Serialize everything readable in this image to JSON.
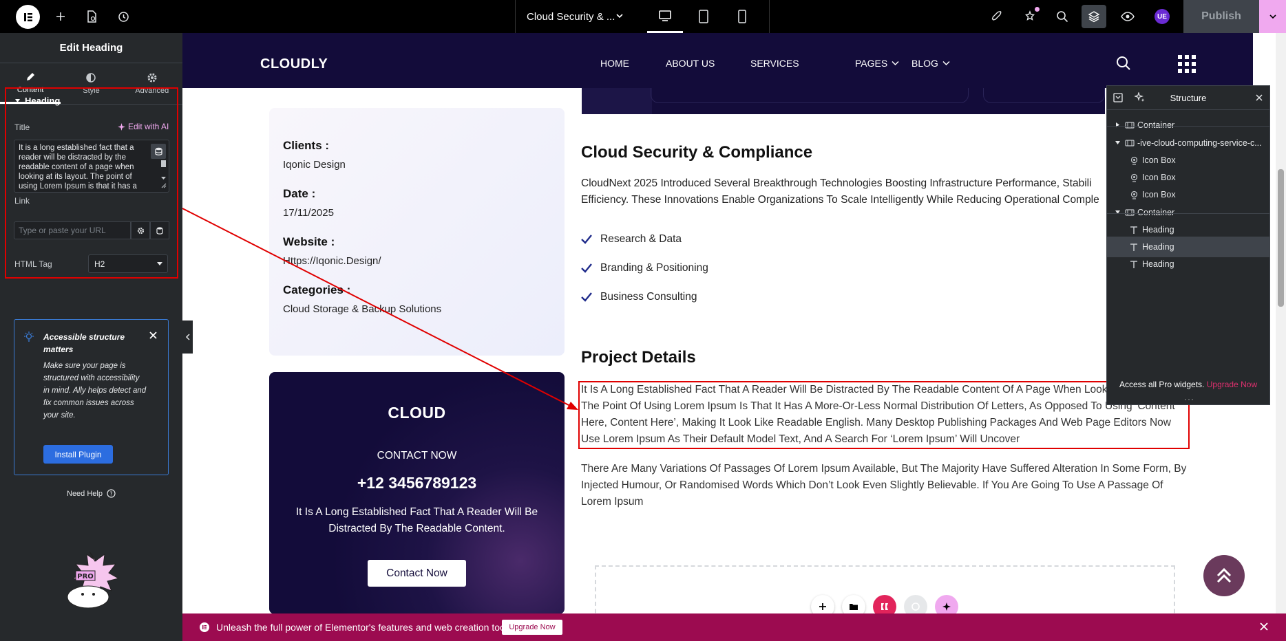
{
  "topbar": {
    "document_title": "Cloud Security & ...",
    "publish_label": "Publish",
    "avatar_initials": "UE"
  },
  "panel": {
    "title": "Edit Heading",
    "tabs": [
      {
        "label": "Content",
        "icon": "pencil-icon",
        "active": true
      },
      {
        "label": "Style",
        "icon": "contrast-icon",
        "active": false
      },
      {
        "label": "Advanced",
        "icon": "gear-icon",
        "active": false
      }
    ],
    "section_title": "Heading",
    "title_label": "Title",
    "edit_ai_label": "Edit with AI",
    "title_value": "It is a long established fact that a reader will be distracted by the readable content of a page when looking at its layout. The point of using Lorem Ipsum is that it has a more-or-less normal distribution of",
    "link_label": "Link",
    "link_placeholder": "Type or paste your URL",
    "html_tag_label": "HTML Tag",
    "html_tag_value": "H2",
    "notice_title": "Accessible structure matters",
    "notice_body": "Make sure your page is structured with accessibility in mind. Ally helps detect and fix common issues across your site.",
    "install_label": "Install Plugin",
    "help_label": "Need Help"
  },
  "site": {
    "brand": "CLOUDLY",
    "nav": [
      {
        "label": "HOME",
        "dropdown": false
      },
      {
        "label": "ABOUT US",
        "dropdown": false
      },
      {
        "label": "SERVICES",
        "dropdown": false
      },
      {
        "label": "PAGES",
        "dropdown": true
      },
      {
        "label": "BLOG",
        "dropdown": true
      }
    ]
  },
  "info": {
    "clients_label": "Clients :",
    "clients_value": "Iqonic Design",
    "date_label": "Date :",
    "date_value": "17/11/2025",
    "website_label": "Website :",
    "website_value": "Https://Iqonic.Design/",
    "categories_label": "Categories :",
    "categories_value": "Cloud Storage & Backup Solutions"
  },
  "main": {
    "heading": "Cloud Security & Compliance",
    "intro_line1": "CloudNext 2025 Introduced Several Breakthrough Technologies Boosting Infrastructure Performance, Stabili",
    "intro_line2": "Efficiency. These Innovations Enable Organizations To Scale Intelligently While Reducing Operational Comple",
    "checklist": [
      "Research & Data",
      "Branding & Positioning",
      "Business Consulting"
    ],
    "project_heading": "Project Details",
    "para1": "It Is A Long Established Fact That A Reader Will Be Distracted By The Readable Content Of A Page When Looking At Its Layout. The Point Of Using Lorem Ipsum Is That It Has A More-Or-Less Normal Distribution Of Letters, As Opposed To Using ‘Content Here, Content Here’, Making It Look Like Readable English. Many Desktop Publishing Packages And Web Page Editors Now Use Lorem Ipsum As Their Default Model Text, And A Search For ‘Lorem Ipsum’ Will Uncover",
    "para2": "There Are Many Variations Of Passages Of Lorem Ipsum Available, But The Majority Have Suffered Alteration In Some Form, By Injected Humour, Or Randomised Words Which Don’t Look Even Slightly Believable. If You Are Going To Use A Passage Of Lorem Ipsum"
  },
  "contact": {
    "title": "CLOUD",
    "subtitle": "CONTACT NOW",
    "phone": "+12 3456789123",
    "description": "It Is A Long Established Fact That A Reader Will Be Distracted By The Readable Content.",
    "button": "Contact Now"
  },
  "structure": {
    "title": "Structure",
    "rows": [
      {
        "label": "Container",
        "icon": "container-icon",
        "toggle": "right",
        "indent": 0,
        "selected": false
      },
      {
        "label": "-ive-cloud-computing-service-c...",
        "icon": "container-icon",
        "toggle": "down",
        "indent": 0,
        "selected": false
      },
      {
        "label": "Icon Box",
        "icon": "icon-box-icon",
        "toggle": "",
        "indent": 1,
        "selected": false
      },
      {
        "label": "Icon Box",
        "icon": "icon-box-icon",
        "toggle": "",
        "indent": 1,
        "selected": false
      },
      {
        "label": "Icon Box",
        "icon": "icon-box-icon",
        "toggle": "",
        "indent": 1,
        "selected": false
      },
      {
        "label": "Container",
        "icon": "container-icon",
        "toggle": "down",
        "indent": 0,
        "selected": false
      },
      {
        "label": "Heading",
        "icon": "heading-icon",
        "toggle": "",
        "indent": 1,
        "selected": false
      },
      {
        "label": "Heading",
        "icon": "heading-icon",
        "toggle": "",
        "indent": 1,
        "selected": true
      },
      {
        "label": "Heading",
        "icon": "heading-icon",
        "toggle": "",
        "indent": 1,
        "selected": false
      }
    ],
    "footer_text": "Access all Pro widgets.",
    "footer_link": "Upgrade Now"
  },
  "banner": {
    "text": "Unleash the full power of Elementor's features and web creation tools.",
    "button": "Upgrade Now"
  },
  "colors": {
    "site_dark": "#130c3a",
    "panel_bg": "#26292c",
    "accent_pink": "#f0a9ef",
    "banner": "#9c0b50",
    "selection": "#e00000"
  }
}
